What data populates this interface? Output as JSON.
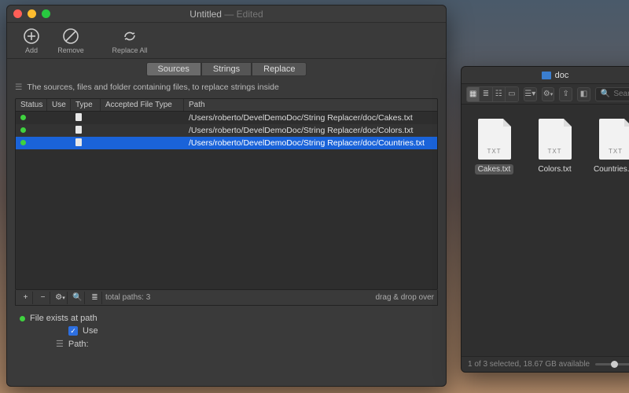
{
  "window": {
    "title": "Untitled",
    "title_suffix": "— Edited",
    "toolbar": {
      "add": "Add",
      "remove": "Remove",
      "replace_all": "Replace All"
    },
    "tabs": {
      "sources": "Sources",
      "strings": "Strings",
      "replace": "Replace",
      "active": "sources"
    },
    "desc": "The sources, files and folder containing files, to replace strings inside",
    "table": {
      "headers": {
        "status": "Status",
        "use": "Use",
        "type": "Type",
        "accepted_file_type": "Accepted File Type",
        "path": "Path"
      },
      "rows": [
        {
          "status": "ok",
          "path": "/Users/roberto/DevelDemoDoc/String Replacer/doc/Cakes.txt",
          "selected": false
        },
        {
          "status": "ok",
          "path": "/Users/roberto/DevelDemoDoc/String Replacer/doc/Colors.txt",
          "selected": false
        },
        {
          "status": "ok",
          "path": "/Users/roberto/DevelDemoDoc/String Replacer/doc/Countries.txt",
          "selected": true
        }
      ]
    },
    "bottombar": {
      "total_paths_label": "total paths: 3",
      "drag_label": "drag & drop over"
    },
    "footer": {
      "file_exists": "File exists at path",
      "use_label": "Use",
      "use_checked": true,
      "path_label": "Path:"
    }
  },
  "finder": {
    "title": "doc",
    "search_placeholder": "Search",
    "items": [
      {
        "name": "Cakes.txt",
        "ext": "TXT",
        "selected": true
      },
      {
        "name": "Colors.txt",
        "ext": "TXT",
        "selected": false
      },
      {
        "name": "Countries.txt",
        "ext": "TXT",
        "selected": false
      }
    ],
    "status": "1 of 3 selected, 18.67 GB available"
  }
}
